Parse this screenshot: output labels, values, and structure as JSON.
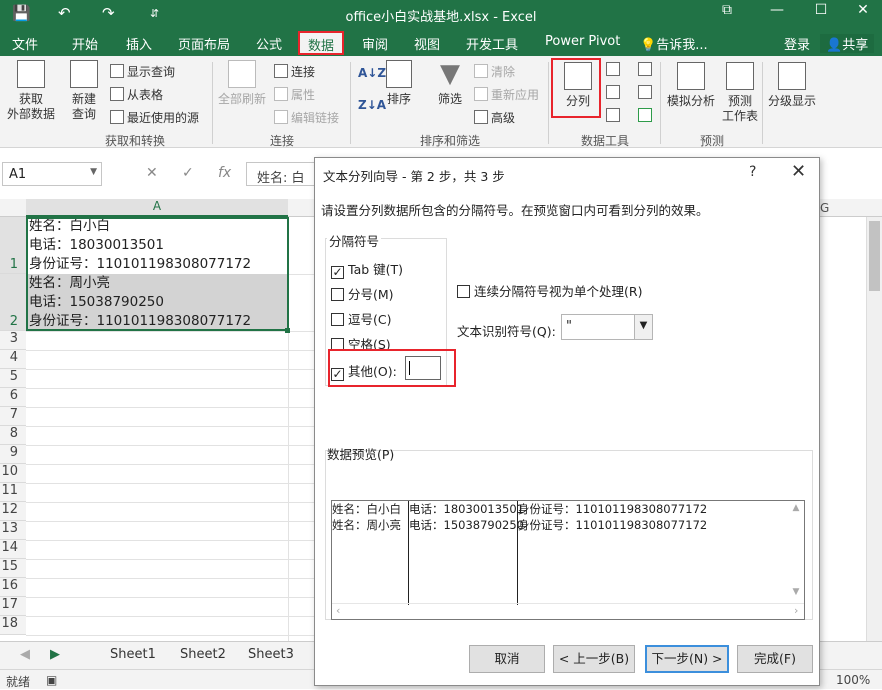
{
  "titlebar": {
    "title": "office小白实战基地.xlsx - Excel",
    "save_icon": "💾",
    "undo_icon": "↶",
    "redo_icon": "↷",
    "customize_icon": "⇵",
    "restore_icon": "⧉",
    "minimize_icon": "—",
    "maximize_icon": "☐",
    "close_icon": "✕"
  },
  "menubar": {
    "tabs": [
      "文件",
      "开始",
      "插入",
      "页面布局",
      "公式",
      "数据",
      "审阅",
      "视图",
      "开发工具",
      "Power Pivot"
    ],
    "tell_me": "告诉我...",
    "login": "登录",
    "share": "共享"
  },
  "ribbon": {
    "get_data": "获取\n外部数据",
    "new_query": "新建\n查询",
    "show_query": "显示查询",
    "from_table": "从表格",
    "recent_sources": "最近使用的源",
    "group_get_transform": "获取和转换",
    "refresh_all": "全部刷新",
    "connections": "连接",
    "properties": "属性",
    "edit_links": "编辑链接",
    "group_connections": "连接",
    "sort": "排序",
    "filter": "筛选",
    "clear": "清除",
    "reapply": "重新应用",
    "advanced": "高级",
    "group_sort_filter": "排序和筛选",
    "text_to_columns": "分列",
    "group_data_tools": "数据工具",
    "what_if": "模拟分析",
    "forecast_sheet": "预测\n工作表",
    "group_forecast": "预测",
    "outline": "分级显示"
  },
  "formula_bar": {
    "name_box": "A1",
    "cancel": "✕",
    "enter": "✓",
    "fx": "fx",
    "content": "姓名: 白"
  },
  "grid": {
    "column_a": "A",
    "column_g": "G",
    "rows": [
      "1",
      "2",
      "3",
      "4",
      "5",
      "6",
      "7",
      "8",
      "9",
      "10",
      "11",
      "12",
      "13",
      "14",
      "15",
      "16",
      "17",
      "18"
    ],
    "cell_a1": [
      "姓名：白小白",
      "电话：18030013501",
      "身份证号：110101198308077172"
    ],
    "cell_a2": [
      "姓名：周小亮",
      "电话：15038790250",
      "身份证号：110101198308077172"
    ]
  },
  "sheets": [
    "Sheet1",
    "Sheet2",
    "Sheet3"
  ],
  "status": {
    "ready": "就绪",
    "zoom": "100%"
  },
  "dialog": {
    "title": "文本分列向导 - 第 2 步，共 3 步",
    "help": "?",
    "close": "✕",
    "description": "请设置分列数据所包含的分隔符号。在预览窗口内可看到分列的效果。",
    "delimiters_label": "分隔符号",
    "tab": "Tab 键(T)",
    "semicolon": "分号(M)",
    "comma": "逗号(C)",
    "space": "空格(S)",
    "other": "其他(O):",
    "consecutive": "连续分隔符号视为单个处理(R)",
    "qualifier_label": "文本识别符号(Q):",
    "qualifier_value": "\"",
    "preview_label": "数据预览(P)",
    "preview_rows": [
      [
        "姓名：白小白",
        "电话：18030013501",
        "身份证号：110101198308077172"
      ],
      [
        "姓名：周小亮",
        "电话：15038790250",
        "身份证号：110101198308077172"
      ]
    ],
    "cancel_btn": "取消",
    "back_btn": "< 上一步(B)",
    "next_btn": "下一步(N) >",
    "finish_btn": "完成(F)"
  },
  "colors": {
    "excel_green": "#217346",
    "highlight_red": "#e8242c"
  }
}
